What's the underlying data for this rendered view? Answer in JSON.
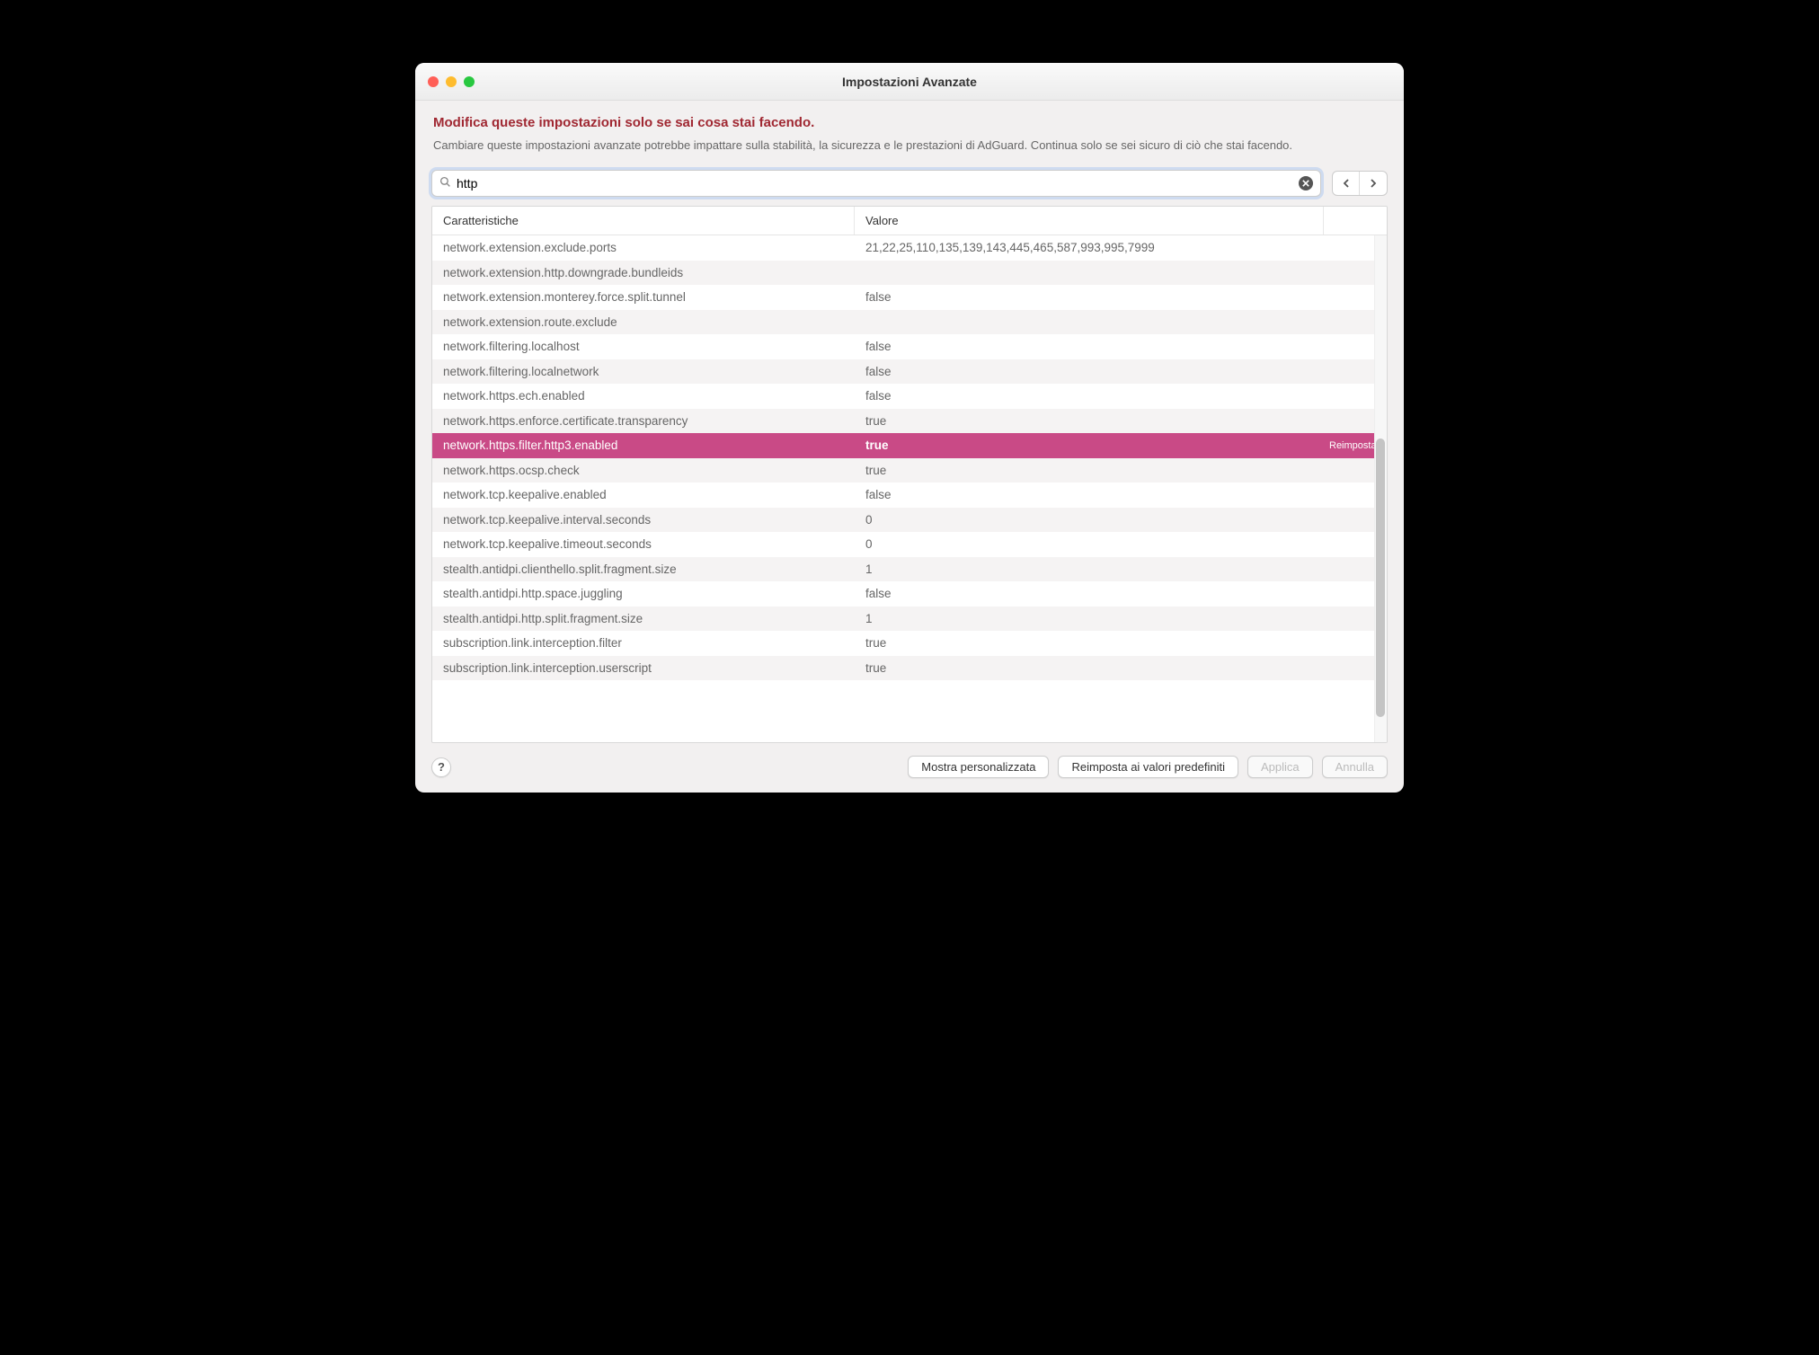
{
  "window": {
    "title": "Impostazioni Avanzate"
  },
  "warning": {
    "title": "Modifica queste impostazioni solo se sai cosa stai facendo.",
    "body": "Cambiare queste impostazioni avanzate potrebbe impattare sulla stabilità, la sicurezza e le prestazioni di AdGuard. Continua solo se sei sicuro di ciò che stai facendo."
  },
  "search": {
    "value": "http"
  },
  "table": {
    "headers": {
      "key": "Caratteristiche",
      "value": "Valore"
    },
    "reset_label": "Reimposta",
    "rows": [
      {
        "key": "network.extension.exclude.ports",
        "value": "21,22,25,110,135,139,143,445,465,587,993,995,7999",
        "selected": false
      },
      {
        "key": "network.extension.http.downgrade.bundleids",
        "value": "",
        "selected": false
      },
      {
        "key": "network.extension.monterey.force.split.tunnel",
        "value": "false",
        "selected": false
      },
      {
        "key": "network.extension.route.exclude",
        "value": "",
        "selected": false
      },
      {
        "key": "network.filtering.localhost",
        "value": "false",
        "selected": false
      },
      {
        "key": "network.filtering.localnetwork",
        "value": "false",
        "selected": false
      },
      {
        "key": "network.https.ech.enabled",
        "value": "false",
        "selected": false
      },
      {
        "key": "network.https.enforce.certificate.transparency",
        "value": "true",
        "selected": false
      },
      {
        "key": "network.https.filter.http3.enabled",
        "value": "true",
        "selected": true
      },
      {
        "key": "network.https.ocsp.check",
        "value": "true",
        "selected": false
      },
      {
        "key": "network.tcp.keepalive.enabled",
        "value": "false",
        "selected": false
      },
      {
        "key": "network.tcp.keepalive.interval.seconds",
        "value": "0",
        "selected": false
      },
      {
        "key": "network.tcp.keepalive.timeout.seconds",
        "value": "0",
        "selected": false
      },
      {
        "key": "stealth.antidpi.clienthello.split.fragment.size",
        "value": "1",
        "selected": false
      },
      {
        "key": "stealth.antidpi.http.space.juggling",
        "value": "false",
        "selected": false
      },
      {
        "key": "stealth.antidpi.http.split.fragment.size",
        "value": "1",
        "selected": false
      },
      {
        "key": "subscription.link.interception.filter",
        "value": "true",
        "selected": false
      },
      {
        "key": "subscription.link.interception.userscript",
        "value": "true",
        "selected": false
      }
    ]
  },
  "footer": {
    "show_custom": "Mostra personalizzata",
    "reset_defaults": "Reimposta ai valori predefiniti",
    "apply": "Applica",
    "cancel": "Annulla"
  }
}
